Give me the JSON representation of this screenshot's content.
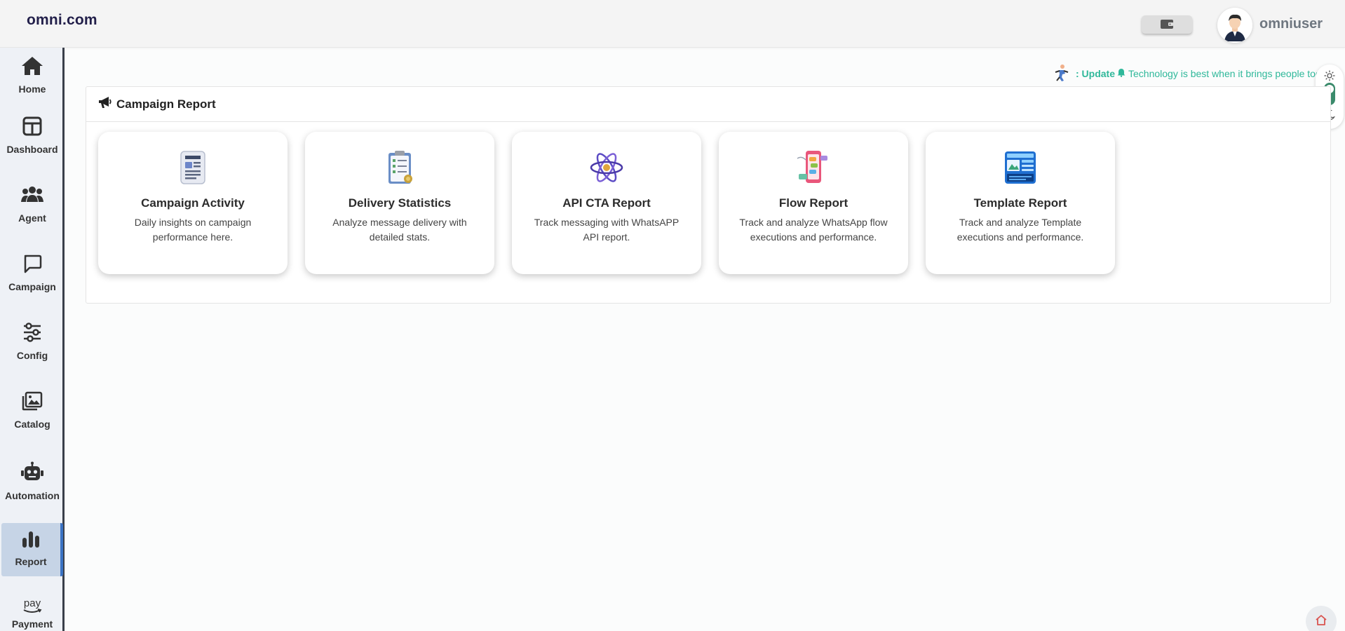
{
  "header": {
    "brand": "omni.com",
    "username": "omniuser",
    "wallet_icon": "wallet-icon",
    "avatar_icon": "user-avatar-icon"
  },
  "sidebar": {
    "items": [
      {
        "label": "Home",
        "icon": "home-icon"
      },
      {
        "label": "Dashboard",
        "icon": "dashboard-icon"
      },
      {
        "label": "Agent",
        "icon": "agents-icon"
      },
      {
        "label": "Campaign",
        "icon": "chat-bubble-icon"
      },
      {
        "label": "Config",
        "icon": "sliders-icon"
      },
      {
        "label": "Catalog",
        "icon": "image-gallery-icon"
      },
      {
        "label": "Automation",
        "icon": "robot-icon"
      },
      {
        "label": "Report",
        "icon": "bar-chart-icon"
      },
      {
        "label": "Payment",
        "icon": "amazon-pay-icon",
        "badge": "pay"
      }
    ],
    "active": "Report"
  },
  "ticker": {
    "prefix": ": Update",
    "message": "Technology is best when it brings people together."
  },
  "panel": {
    "title": "Campaign Report",
    "cards": [
      {
        "title": "Campaign Activity",
        "description": "Daily insights on campaign performance here."
      },
      {
        "title": "Delivery Statistics",
        "description": "Analyze message delivery with detailed stats."
      },
      {
        "title": "API CTA Report",
        "description": "Track messaging with WhatsAPP API report."
      },
      {
        "title": "Flow Report",
        "description": "Track and analyze WhatsApp flow executions and performance."
      },
      {
        "title": "Template Report",
        "description": "Track and analyze Template executions and performance."
      }
    ]
  },
  "colors": {
    "accent_green": "#2fb89a",
    "active_nav_bg": "#c6d4e6",
    "active_nav_border": "#3b73c4",
    "toggle_green": "#3a8a6b"
  }
}
